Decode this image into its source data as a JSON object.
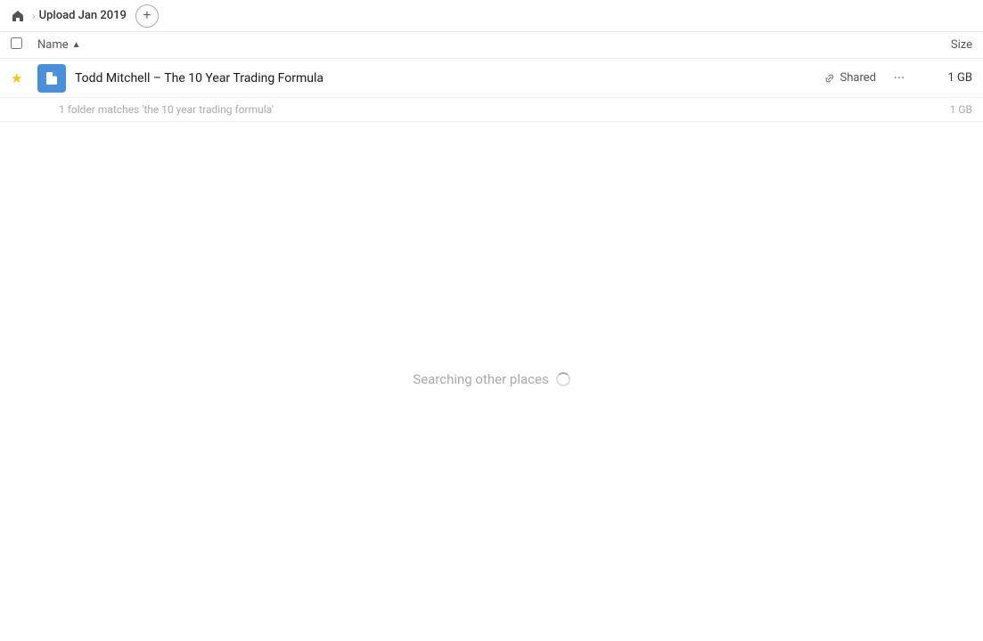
{
  "header": {
    "home_icon": "home",
    "breadcrumb": "Upload Jan 2019",
    "add_button_label": "+"
  },
  "table": {
    "col_name_label": "Name",
    "col_size_label": "Size",
    "sort_direction": "asc"
  },
  "file_row": {
    "name": "Todd Mitchell – The 10 Year Trading Formula",
    "shared_label": "Shared",
    "more_icon": "···",
    "size": "1 GB",
    "is_starred": true,
    "match_text": "1 folder matches 'the 10 year trading formula'",
    "match_size": "1 GB"
  },
  "searching": {
    "label": "Searching other places"
  }
}
